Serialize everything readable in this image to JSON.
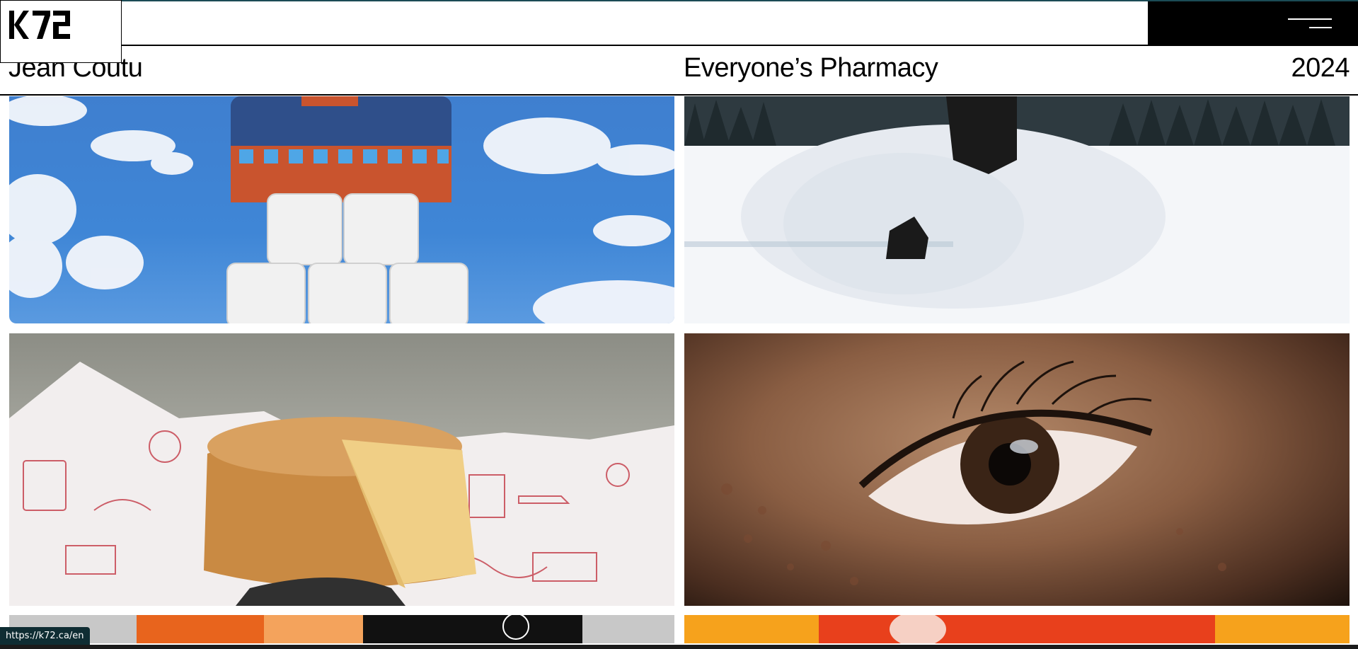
{
  "header": {
    "logo_text": "K72",
    "menu_icon": "hamburger-menu-icon"
  },
  "project": {
    "client": "Jean Coutu",
    "tagline": "Everyone’s Pharmacy",
    "year": "2024"
  },
  "gallery": {
    "tiles": [
      {
        "subject": "toilet-paper-rolls-under-knit-tuque-sky"
      },
      {
        "subject": "snowmobile-spraying-snow"
      },
      {
        "subject": "cheese-wheel-on-printed-paper"
      },
      {
        "subject": "close-up-eye-freckles"
      },
      {
        "subject": "orange-black-packaging"
      },
      {
        "subject": "red-object-on-orange"
      }
    ]
  },
  "browser": {
    "status_url": "https://k72.ca/en"
  },
  "colors": {
    "accent": "#1b4b55",
    "menu_background": "#000000",
    "status_background": "#0f2d33"
  }
}
